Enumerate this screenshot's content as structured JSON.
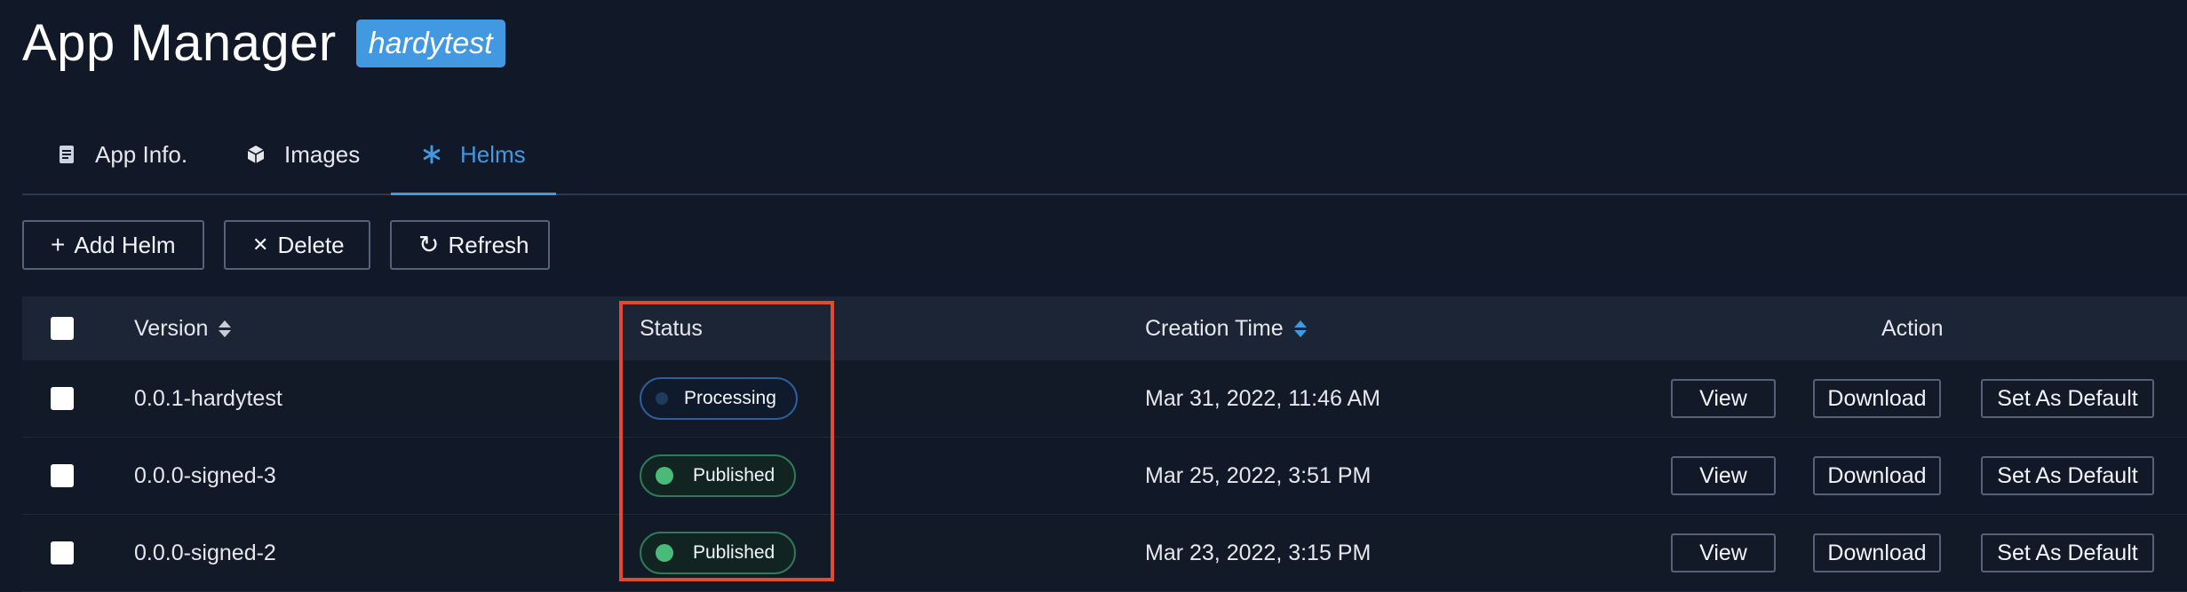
{
  "header": {
    "title": "App Manager",
    "badge": "hardytest"
  },
  "tabs": [
    {
      "label": "App Info.",
      "icon": "document-icon",
      "active": false
    },
    {
      "label": "Images",
      "icon": "cube-icon",
      "active": false
    },
    {
      "label": "Helms",
      "icon": "asterisk-icon",
      "active": true
    }
  ],
  "toolbar": {
    "add": {
      "glyph": "+",
      "label": "Add Helm"
    },
    "delete": {
      "glyph": "✕",
      "label": "Delete"
    },
    "refresh": {
      "glyph": "↻",
      "label": "Refresh"
    }
  },
  "table": {
    "columns": {
      "version": "Version",
      "status": "Status",
      "creation_time": "Creation Time",
      "action": "Action"
    },
    "rows": [
      {
        "version": "0.0.1-hardytest",
        "status": "Processing",
        "created": "Mar 31, 2022, 11:46 AM"
      },
      {
        "version": "0.0.0-signed-3",
        "status": "Published",
        "created": "Mar 25, 2022, 3:51 PM"
      },
      {
        "version": "0.0.0-signed-2",
        "status": "Published",
        "created": "Mar 23, 2022, 3:15 PM"
      }
    ],
    "actions": {
      "view": "View",
      "download": "Download",
      "set_default": "Set As Default"
    }
  },
  "colors": {
    "background": "#111827",
    "accent": "#4299e1",
    "published": "#48bb78",
    "highlight": "#e44a32"
  }
}
